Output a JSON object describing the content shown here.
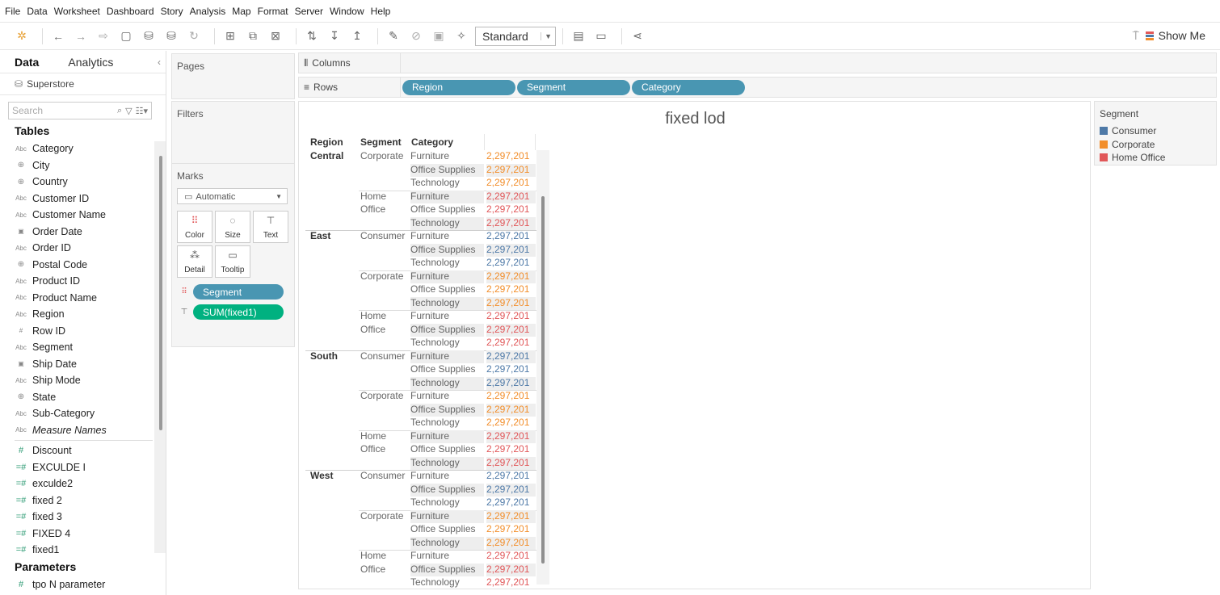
{
  "menu": [
    "File",
    "Data",
    "Worksheet",
    "Dashboard",
    "Story",
    "Analysis",
    "Map",
    "Format",
    "Server",
    "Window",
    "Help"
  ],
  "toolbar": {
    "view_mode": "Standard",
    "show_me": "Show Me"
  },
  "left_pane": {
    "tabs": [
      "Data",
      "Analytics"
    ],
    "datasource": "Superstore",
    "search_placeholder": "Search",
    "tables_title": "Tables",
    "fields": [
      {
        "name": "Category",
        "type": "abc"
      },
      {
        "name": "City",
        "type": "geo"
      },
      {
        "name": "Country",
        "type": "geo"
      },
      {
        "name": "Customer ID",
        "type": "abc"
      },
      {
        "name": "Customer Name",
        "type": "abc"
      },
      {
        "name": "Order Date",
        "type": "date"
      },
      {
        "name": "Order ID",
        "type": "abc"
      },
      {
        "name": "Postal Code",
        "type": "geo"
      },
      {
        "name": "Product ID",
        "type": "abc"
      },
      {
        "name": "Product Name",
        "type": "abc"
      },
      {
        "name": "Region",
        "type": "abc"
      },
      {
        "name": "Row ID",
        "type": "num"
      },
      {
        "name": "Segment",
        "type": "abc"
      },
      {
        "name": "Ship Date",
        "type": "date"
      },
      {
        "name": "Ship Mode",
        "type": "abc"
      },
      {
        "name": "State",
        "type": "geo"
      },
      {
        "name": "Sub-Category",
        "type": "abc"
      },
      {
        "name": "Measure Names",
        "type": "abc",
        "italic": true
      }
    ],
    "measures": [
      {
        "name": "Discount",
        "type": "num"
      },
      {
        "name": "EXCULDE I",
        "type": "calc"
      },
      {
        "name": "exculde2",
        "type": "calc"
      },
      {
        "name": "fixed 2",
        "type": "calc"
      },
      {
        "name": "fixed 3",
        "type": "calc"
      },
      {
        "name": "FIXED 4",
        "type": "calc"
      },
      {
        "name": "fixed1",
        "type": "calc"
      }
    ],
    "parameters_title": "Parameters",
    "parameters": [
      {
        "name": "tpo N parameter",
        "type": "num"
      }
    ]
  },
  "cards": {
    "pages": "Pages",
    "filters": "Filters",
    "marks": "Marks",
    "mark_type": "Automatic",
    "mark_buttons": [
      "Color",
      "Size",
      "Text",
      "Detail",
      "Tooltip"
    ],
    "mark_pills": [
      "Segment",
      "SUM(fixed1)"
    ]
  },
  "shelves": {
    "columns_label": "Columns",
    "rows_label": "Rows",
    "rows_pills": [
      "Region",
      "Segment",
      "Category"
    ]
  },
  "viz": {
    "title": "fixed lod",
    "headers": [
      "Region",
      "Segment",
      "Category"
    ],
    "regions": [
      "Central",
      "East",
      "South",
      "West"
    ],
    "value": "2,297,201",
    "segment_labels": {
      "Consumer": "Consumer",
      "Corporate": "Corporate",
      "Home Office": "Home Office"
    },
    "categories": [
      "Furniture",
      "Office Supplies",
      "Technology"
    ]
  },
  "legend": {
    "title": "Segment",
    "items": [
      {
        "label": "Consumer",
        "color": "#4e79a7"
      },
      {
        "label": "Corporate",
        "color": "#f28e2b"
      },
      {
        "label": "Home Office",
        "color": "#e15759"
      }
    ]
  }
}
